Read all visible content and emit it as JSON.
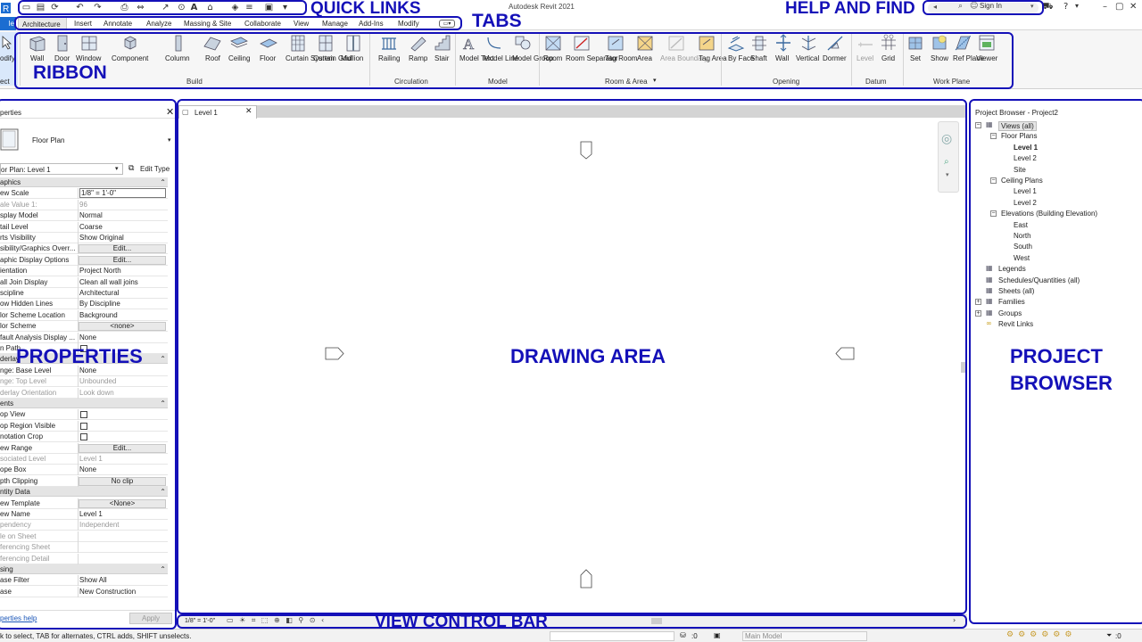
{
  "app_title": "Autodesk Revit 2021",
  "header": {
    "sign_in": "Sign In"
  },
  "tabs": [
    "le",
    "Architecture",
    "Insert",
    "Annotate",
    "Analyze",
    "Massing & Site",
    "Collaborate",
    "View",
    "Manage",
    "Add-Ins",
    "Modify"
  ],
  "ribbon": {
    "modify": {
      "label": "odify",
      "sub": "ect"
    },
    "build": {
      "group": "Build",
      "items": [
        "Wall",
        "Door",
        "Window",
        "Component",
        "Column",
        "Roof",
        "Ceiling",
        "Floor",
        "Curtain System",
        "Curtain Grid",
        "Mullion"
      ]
    },
    "circulation": {
      "group": "Circulation",
      "items": [
        "Railing",
        "Ramp",
        "Stair"
      ]
    },
    "model": {
      "group": "Model",
      "items": [
        "Model Text",
        "Model Line",
        "Model Group"
      ]
    },
    "room_area": {
      "group": "Room & Area",
      "items": [
        "Room",
        "Room Separator",
        "Tag Room",
        "Area",
        "Area Boundary",
        "Tag Area"
      ]
    },
    "opening": {
      "group": "Opening",
      "items": [
        "By Face",
        "Shaft",
        "Wall",
        "Vertical",
        "Dormer"
      ]
    },
    "datum": {
      "group": "Datum",
      "items": [
        "Level",
        "Grid"
      ]
    },
    "work_plane": {
      "group": "Work Plane",
      "items": [
        "Set",
        "Show",
        "Ref Plane",
        "Viewer"
      ]
    }
  },
  "properties": {
    "title": "perties",
    "type_name": "Floor Plan",
    "instance": "or Plan: Level 1",
    "edit_type": "Edit Type",
    "rows": [
      {
        "kind": "sec",
        "label": "aphics"
      },
      {
        "label": "ew Scale",
        "value": "1/8\" = 1'-0\"",
        "type": "input"
      },
      {
        "label": "ale Value    1:",
        "value": "96",
        "ro": true
      },
      {
        "label": "splay Model",
        "value": "Normal"
      },
      {
        "label": "tail Level",
        "value": "Coarse"
      },
      {
        "label": "rts Visibility",
        "value": "Show Original"
      },
      {
        "label": "sibility/Graphics Overr...",
        "value": "Edit...",
        "type": "button"
      },
      {
        "label": "aphic Display Options",
        "value": "Edit...",
        "type": "button"
      },
      {
        "label": "ientation",
        "value": "Project North"
      },
      {
        "label": "all Join Display",
        "value": "Clean all wall joins"
      },
      {
        "label": "scipline",
        "value": "Architectural"
      },
      {
        "label": "ow Hidden Lines",
        "value": "By Discipline"
      },
      {
        "label": "lor Scheme Location",
        "value": "Background"
      },
      {
        "label": "lor Scheme",
        "value": "<none>",
        "type": "button"
      },
      {
        "label": "fault Analysis Display ...",
        "value": "None"
      },
      {
        "label": "n Path",
        "value": "",
        "type": "check"
      },
      {
        "kind": "sec",
        "label": "derlay"
      },
      {
        "label": "nge: Base Level",
        "value": "None"
      },
      {
        "label": "nge: Top Level",
        "value": "Unbounded",
        "ro": true
      },
      {
        "label": "derlay Orientation",
        "value": "Look down",
        "ro": true
      },
      {
        "kind": "sec",
        "label": "ents"
      },
      {
        "label": "op View",
        "value": "",
        "type": "check"
      },
      {
        "label": "op Region Visible",
        "value": "",
        "type": "check"
      },
      {
        "label": "notation Crop",
        "value": "",
        "type": "check"
      },
      {
        "label": "ew Range",
        "value": "Edit...",
        "type": "button"
      },
      {
        "label": "sociated Level",
        "value": "Level 1",
        "ro": true
      },
      {
        "label": "ope Box",
        "value": "None"
      },
      {
        "label": "pth Clipping",
        "value": "No clip",
        "type": "button"
      },
      {
        "kind": "sec",
        "label": "ntity Data"
      },
      {
        "label": "ew Template",
        "value": "<None>",
        "type": "button"
      },
      {
        "label": "ew Name",
        "value": "Level 1"
      },
      {
        "label": "pendency",
        "value": "Independent",
        "ro": true
      },
      {
        "label": "le on Sheet",
        "value": "",
        "ro": true
      },
      {
        "label": "ferencing Sheet",
        "value": "",
        "ro": true
      },
      {
        "label": "ferencing Detail",
        "value": "",
        "ro": true
      },
      {
        "kind": "sec",
        "label": "sing"
      },
      {
        "label": "ase Filter",
        "value": "Show All"
      },
      {
        "label": "ase",
        "value": "New Construction"
      }
    ],
    "help_link": "perties help",
    "apply": "Apply"
  },
  "drawing": {
    "tab": "Level 1",
    "scale": "1/8\" = 1'-0\""
  },
  "browser": {
    "title": "Project Browser - Project2",
    "tree": [
      {
        "label": "Views (all)",
        "level": 0,
        "exp": "-",
        "sel": true
      },
      {
        "label": "Floor Plans",
        "level": 1,
        "exp": "-"
      },
      {
        "label": "Level 1",
        "level": 2,
        "bold": true
      },
      {
        "label": "Level 2",
        "level": 2
      },
      {
        "label": "Site",
        "level": 2
      },
      {
        "label": "Ceiling Plans",
        "level": 1,
        "exp": "-"
      },
      {
        "label": "Level 1",
        "level": 2
      },
      {
        "label": "Level 2",
        "level": 2
      },
      {
        "label": "Elevations (Building Elevation)",
        "level": 1,
        "exp": "-"
      },
      {
        "label": "East",
        "level": 2
      },
      {
        "label": "North",
        "level": 2
      },
      {
        "label": "South",
        "level": 2
      },
      {
        "label": "West",
        "level": 2
      },
      {
        "label": "Legends",
        "level": 0
      },
      {
        "label": "Schedules/Quantities (all)",
        "level": 0
      },
      {
        "label": "Sheets (all)",
        "level": 0
      },
      {
        "label": "Families",
        "level": 0,
        "exp": "+"
      },
      {
        "label": "Groups",
        "level": 0,
        "exp": "+"
      },
      {
        "label": "Revit Links",
        "level": 0
      }
    ]
  },
  "status": {
    "hint": "k to select, TAB for alternates, CTRL adds, SHIFT unselects.",
    "workset": ":0",
    "model": "Main Model",
    "filter": ":0"
  },
  "annotations": {
    "quick_links": "QUICK LINKS",
    "tabs": "TABS",
    "help_and_find": "HELP AND FIND",
    "ribbon": "RIBBON",
    "properties": "PROPERTIES",
    "drawing_area": "DRAWING AREA",
    "project_browser_1": "PROJECT",
    "project_browser_2": "BROWSER",
    "view_control_bar": "VIEW CONTROL BAR"
  },
  "colors": {
    "annotation": "#1410b8",
    "file_tab": "#1b6dd1"
  }
}
